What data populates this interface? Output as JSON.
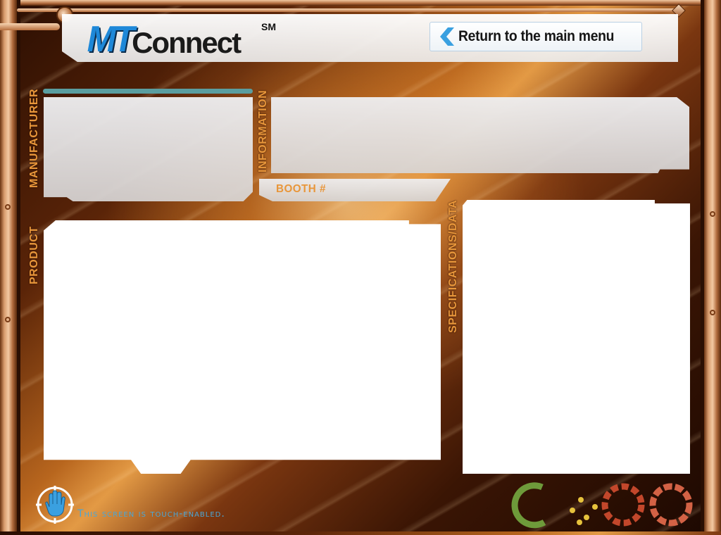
{
  "header": {
    "logo_mt": "MT",
    "logo_connect": "Connect",
    "logo_mark": "SM",
    "return_button_label": "Return to the main menu"
  },
  "labels": {
    "manufacturer": "MANUFACTURER",
    "information": "INFORMATION",
    "booth": "BOOTH #",
    "product": "PRODUCT",
    "specifications": "SPECIFICATIONS/DATA"
  },
  "footer": {
    "touch_text": "This screen is touch-enabled."
  },
  "colors": {
    "accent_orange": "#e8963a",
    "accent_blue": "#4aa6d6",
    "teal": "#5a9ea0"
  },
  "icons": {
    "back": "chevron-left-icon",
    "touch": "touch-hand-icon",
    "decoration": "gear-decoration-icon"
  }
}
